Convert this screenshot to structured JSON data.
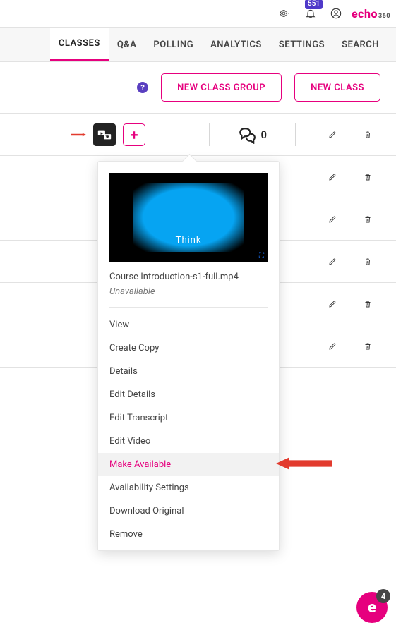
{
  "topbar": {
    "notification_count": "551"
  },
  "logo": {
    "brand": "echo",
    "suffix": "360"
  },
  "tabs": [
    {
      "label": "CLASSES",
      "active": true
    },
    {
      "label": "Q&A",
      "active": false
    },
    {
      "label": "POLLING",
      "active": false
    },
    {
      "label": "ANALYTICS",
      "active": false
    },
    {
      "label": "SETTINGS",
      "active": false
    },
    {
      "label": "SEARCH",
      "active": false
    }
  ],
  "header": {
    "help_glyph": "?",
    "new_group_label": "NEW CLASS GROUP",
    "new_class_label": "NEW CLASS"
  },
  "first_row": {
    "plus": "+",
    "chat_count": "0"
  },
  "popover": {
    "thumbnail_text": "Think",
    "file_name": "Course Introduction-s1-full.mp4",
    "status": "Unavailable",
    "menu": [
      {
        "label": "View"
      },
      {
        "label": "Create Copy"
      },
      {
        "label": "Details"
      },
      {
        "label": "Edit Details"
      },
      {
        "label": "Edit Transcript"
      },
      {
        "label": "Edit Video"
      },
      {
        "label": "Make Available",
        "highlight": true
      },
      {
        "label": "Availability Settings"
      },
      {
        "label": "Download Original"
      },
      {
        "label": "Remove"
      }
    ]
  },
  "fab": {
    "glyph": "e",
    "badge": "4"
  }
}
